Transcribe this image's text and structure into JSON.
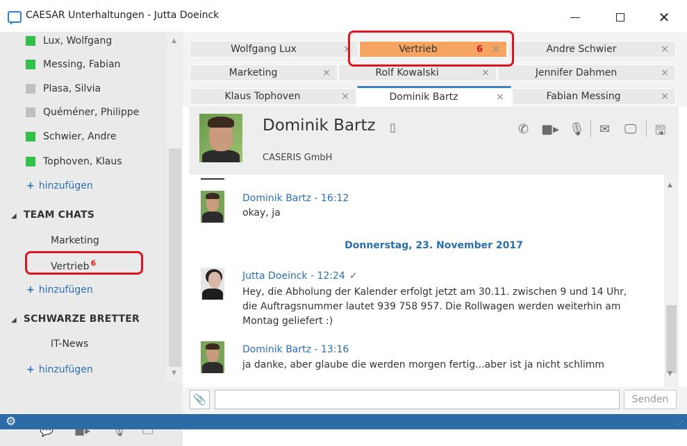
{
  "window": {
    "title": "CAESAR Unterhaltungen - Jutta Doeinck"
  },
  "sidebar": {
    "contacts": [
      {
        "name": "Lux, Wolfgang",
        "status": "green"
      },
      {
        "name": "Messing, Fabian",
        "status": "green"
      },
      {
        "name": "Plasa, Silvia",
        "status": "grey"
      },
      {
        "name": "Quéméner, Philippe",
        "status": "grey"
      },
      {
        "name": "Schwier, Andre",
        "status": "green"
      },
      {
        "name": "Tophoven, Klaus",
        "status": "green"
      }
    ],
    "add_label": "hinzufügen",
    "add_symbol": "+",
    "team_chats": {
      "title": "TEAM CHATS",
      "items": [
        {
          "name": "Marketing",
          "badge": ""
        },
        {
          "name": "Vertrieb",
          "badge": "6"
        }
      ]
    },
    "boards": {
      "title": "SCHWARZE BRETTER",
      "items": [
        {
          "name": "IT-News"
        }
      ]
    }
  },
  "tabs": [
    [
      {
        "label": "Wolfgang Lux"
      },
      {
        "label": "Vertrieb",
        "badge": "6"
      },
      {
        "label": "Andre Schwier"
      }
    ],
    [
      {
        "label": "Marketing"
      },
      {
        "label": "Rolf Kowalski"
      },
      {
        "label": "Jennifer Dahmen"
      }
    ],
    [
      {
        "label": "Klaus Tophoven"
      },
      {
        "label": "Dominik Bartz"
      },
      {
        "label": "Fabian Messing"
      }
    ]
  ],
  "tab_close": "×",
  "contact": {
    "name": "Dominik Bartz",
    "company": "CASERIS GmbH"
  },
  "messages": [
    {
      "author": "Dominik Bartz - 16:12",
      "text": "okay, ja"
    },
    {
      "date": "Donnerstag, 23. November 2017"
    },
    {
      "author": "Jutta Doeinck - 12:24",
      "check": "✓",
      "text": "Hey, die Abholung der Kalender erfolgt jetzt am 30.11. zwischen 9 und 14 Uhr, die Auftragsnummer lautet 939 758 957. Die Rollwagen werden weiterhin am Montag geliefert :)"
    },
    {
      "author": "Dominik Bartz - 13:16",
      "text": "ja danke, aber glaube die werden morgen fertig...aber ist ja nicht schlimm"
    }
  ],
  "composer": {
    "placeholder": "",
    "send_label": "Senden"
  },
  "colors": {
    "accent": "#2b6ca8",
    "link": "#2a6fb0",
    "online": "#33c04a",
    "highlight": "#e0141e",
    "active_tab": "#f5a462"
  }
}
